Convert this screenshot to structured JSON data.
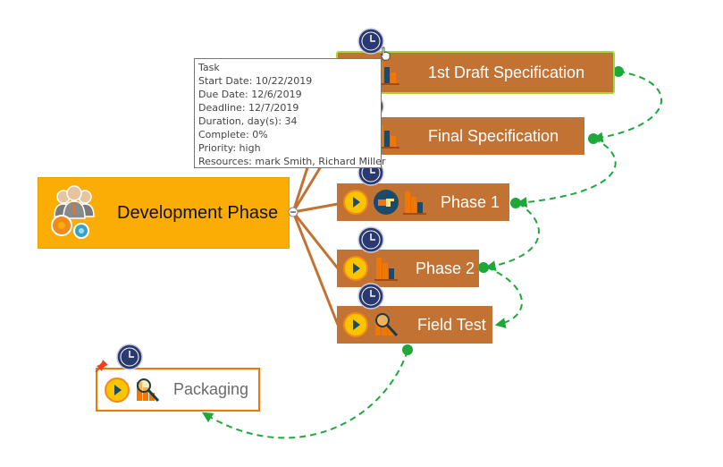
{
  "mindmap": {
    "root": {
      "label": "Development Phase",
      "icon": "team-gears-icon",
      "color": "#fbad06"
    },
    "branch_color": "#c27232",
    "link_color": "#1fa83a",
    "nodes": [
      {
        "label": "1st Draft Specification",
        "icons": [
          "progress-complete-icon",
          "bar-chart-icon"
        ],
        "selected": true
      },
      {
        "label": "Final Specification",
        "icons": [
          "progress-complete-icon",
          "bar-chart-icon"
        ]
      },
      {
        "label": "Phase 1",
        "icons": [
          "play-icon",
          "pointing-hand-icon",
          "bar-chart-icon"
        ]
      },
      {
        "label": "Phase 2",
        "icons": [
          "play-icon",
          "bar-chart-icon"
        ]
      },
      {
        "label": "Field Test",
        "icons": [
          "play-icon",
          "chart-magnifier-icon"
        ]
      }
    ],
    "floating": {
      "label": "Packaging",
      "icons": [
        "play-icon",
        "chart-magnifier-icon"
      ],
      "pinned": true,
      "border_color": "#f07800"
    }
  },
  "tooltip": {
    "lines": [
      "Task",
      "Start Date: 10/22/2019",
      "Due Date: 12/6/2019",
      "Deadline: 12/7/2019",
      "Duration, day(s): 34",
      "Complete: 0%",
      "Priority: high",
      "Resources: mark Smith, Richard Miller"
    ]
  }
}
